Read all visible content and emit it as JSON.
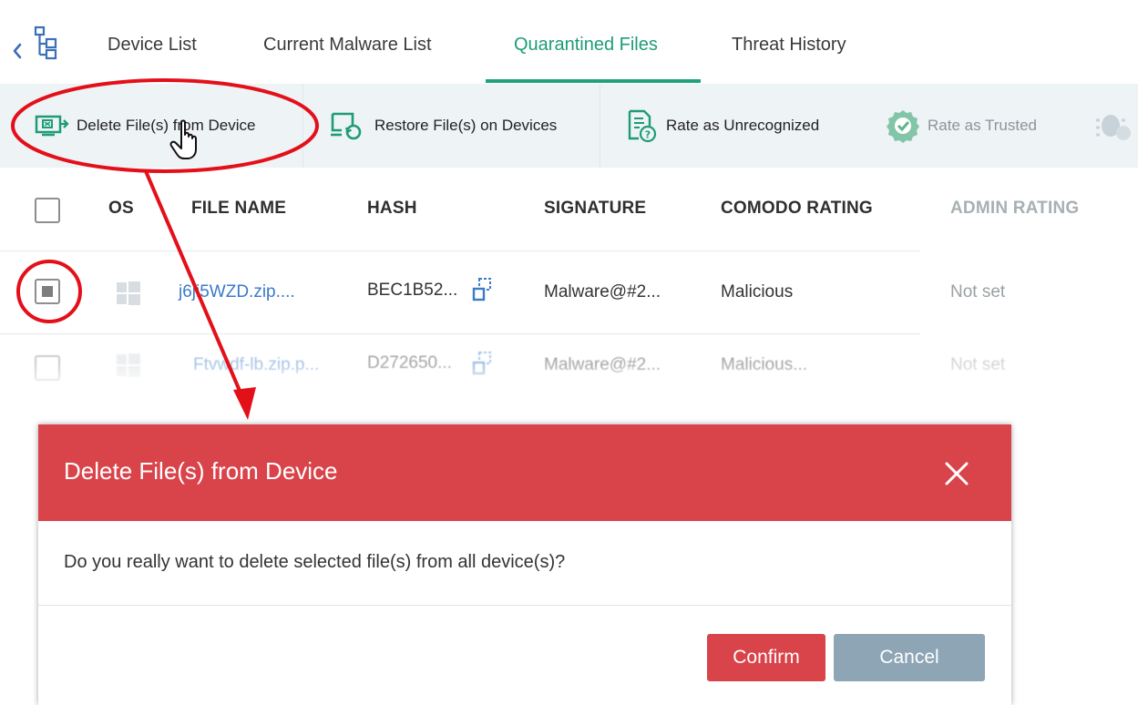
{
  "tabs": {
    "items": [
      {
        "label": "Device List",
        "active": false
      },
      {
        "label": "Current Malware List",
        "active": false
      },
      {
        "label": "Quarantined Files",
        "active": true
      },
      {
        "label": "Threat History",
        "active": false
      }
    ]
  },
  "toolbar": {
    "delete_label": "Delete File(s) from Device",
    "restore_label": "Restore File(s) on Devices",
    "unrecognized_label": "Rate as Unrecognized",
    "trusted_label": "Rate as Trusted"
  },
  "table": {
    "columns": [
      "OS",
      "FILE NAME",
      "HASH",
      "SIGNATURE",
      "COMODO RATING",
      "ADMIN RATING"
    ],
    "rows": [
      {
        "os": "windows",
        "file_name": "j6ji5WZD.zip....",
        "hash": "BEC1B52...",
        "signature": "Malware@#2...",
        "comodo_rating": "Malicious",
        "admin_rating": "Not set",
        "checked": true
      },
      {
        "os": "windows",
        "file_name": "Ftvwdf-lb.zip.p...",
        "hash": "D272650...",
        "signature": "Malware@#2...",
        "comodo_rating": "Malicious...",
        "admin_rating": "Not set",
        "checked": false
      }
    ]
  },
  "dialog": {
    "title": "Delete File(s) from Device",
    "message": "Do you really want to delete selected file(s) from all device(s)?",
    "confirm_label": "Confirm",
    "cancel_label": "Cancel"
  },
  "colors": {
    "accent_green": "#20a37b",
    "dialog_red": "#d9434a",
    "cancel_gray": "#8ea5b6",
    "annotation_red": "#e3101a"
  },
  "icons": {
    "back": "chevron-left-icon",
    "tree": "tree-icon",
    "delete": "delete-from-device-icon",
    "restore": "restore-on-device-icon",
    "unrecognized": "rate-unrecognized-icon",
    "trusted": "rate-trusted-icon",
    "copy": "copy-hash-icon",
    "os": "windows-icon",
    "close": "close-icon",
    "cursor": "hand-cursor-icon"
  }
}
